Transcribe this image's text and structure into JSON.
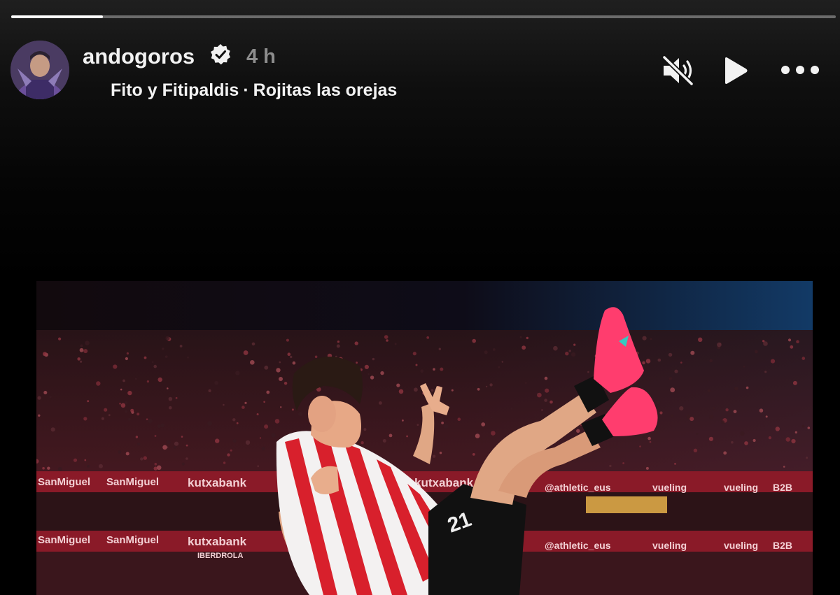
{
  "story": {
    "progress_fraction": 0.111,
    "header": {
      "username": "andogoros",
      "verified": true,
      "timestamp": "4 h",
      "music": {
        "artist": "Fito y Fitipaldis",
        "separator": "·",
        "song": "Rojitas las orejas"
      }
    },
    "controls": {
      "mute_icon": "speaker-muted-icon",
      "play_icon": "play-icon",
      "more_icon": "more-horizontal-icon"
    },
    "photo": {
      "ad_boards": [
        "SanMiguel",
        "SanMiguel",
        "kutxabank",
        "kutxabank",
        "@athletic_eus",
        "vueling",
        "vueling",
        "B2B",
        "SanMiguel",
        "SanMiguel",
        "kutxabank",
        "@athletic_eus",
        "vueling",
        "vueling",
        "B2B",
        "IBERDROLA"
      ],
      "shorts_number": "21",
      "colors": {
        "stripe_red": "#d8202c",
        "stripe_white": "#f3f1f1",
        "boot": "#ff3d6e"
      }
    }
  }
}
